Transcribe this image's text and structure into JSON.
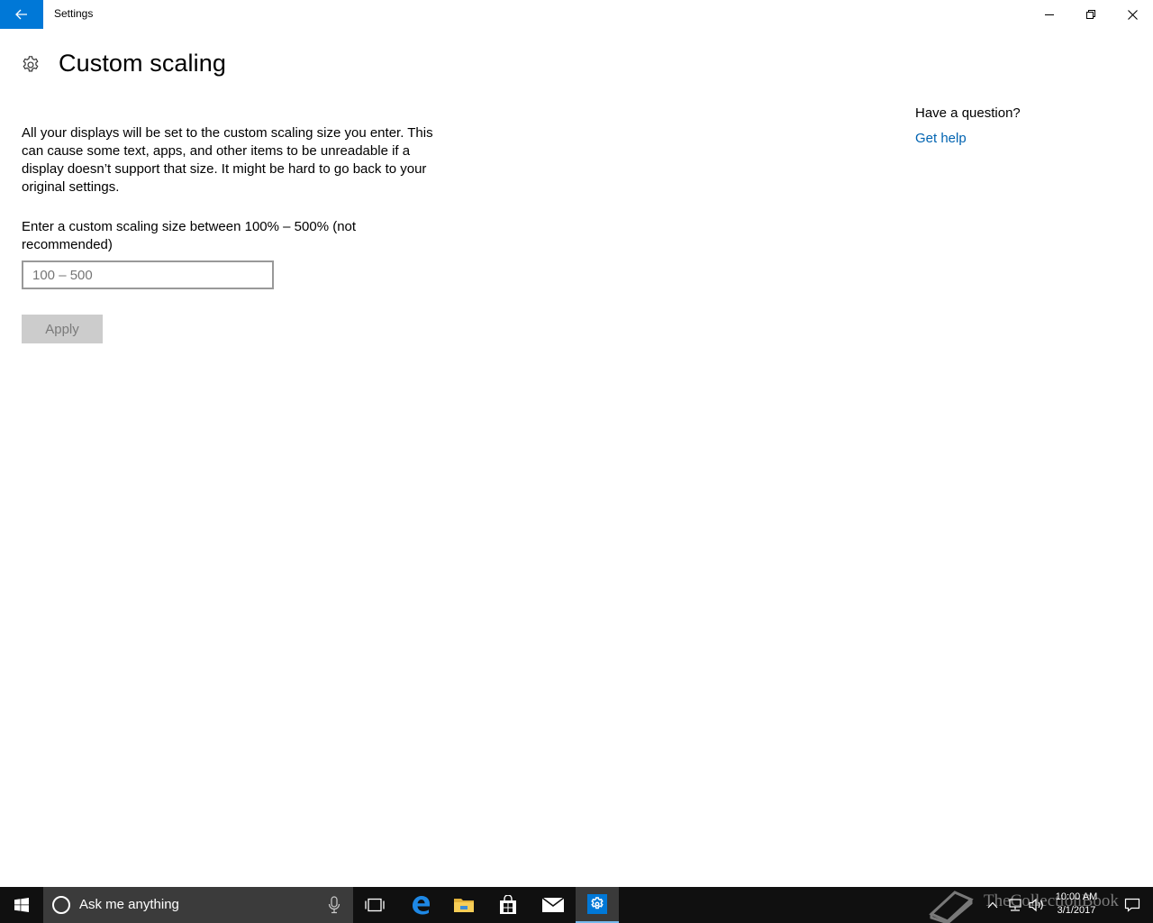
{
  "window": {
    "title": "Settings"
  },
  "page": {
    "title": "Custom scaling",
    "description": "All your displays will be set to the custom scaling size you enter. This can cause some text, apps, and other items to be unreadable if a display doesn’t support that size. It might be hard to go back to your original settings.",
    "input_label": "Enter a custom scaling size between 100% – 500% (not recommended)",
    "input_placeholder": "100 – 500",
    "input_value": "",
    "apply_label": "Apply"
  },
  "help": {
    "question": "Have a question?",
    "link": "Get help"
  },
  "taskbar": {
    "search_placeholder": "Ask me anything",
    "apps": [
      "task-view",
      "edge",
      "file-explorer",
      "store",
      "mail",
      "settings"
    ],
    "active_app": "settings",
    "watermark": "TheCollectionBook",
    "time": "10:00 AM",
    "date": "3/1/2017"
  },
  "colors": {
    "accent": "#0078d7",
    "link": "#0063b1",
    "taskbar": "#101010",
    "search_box": "#3b3b3b",
    "button_disabled": "#cccccc"
  }
}
